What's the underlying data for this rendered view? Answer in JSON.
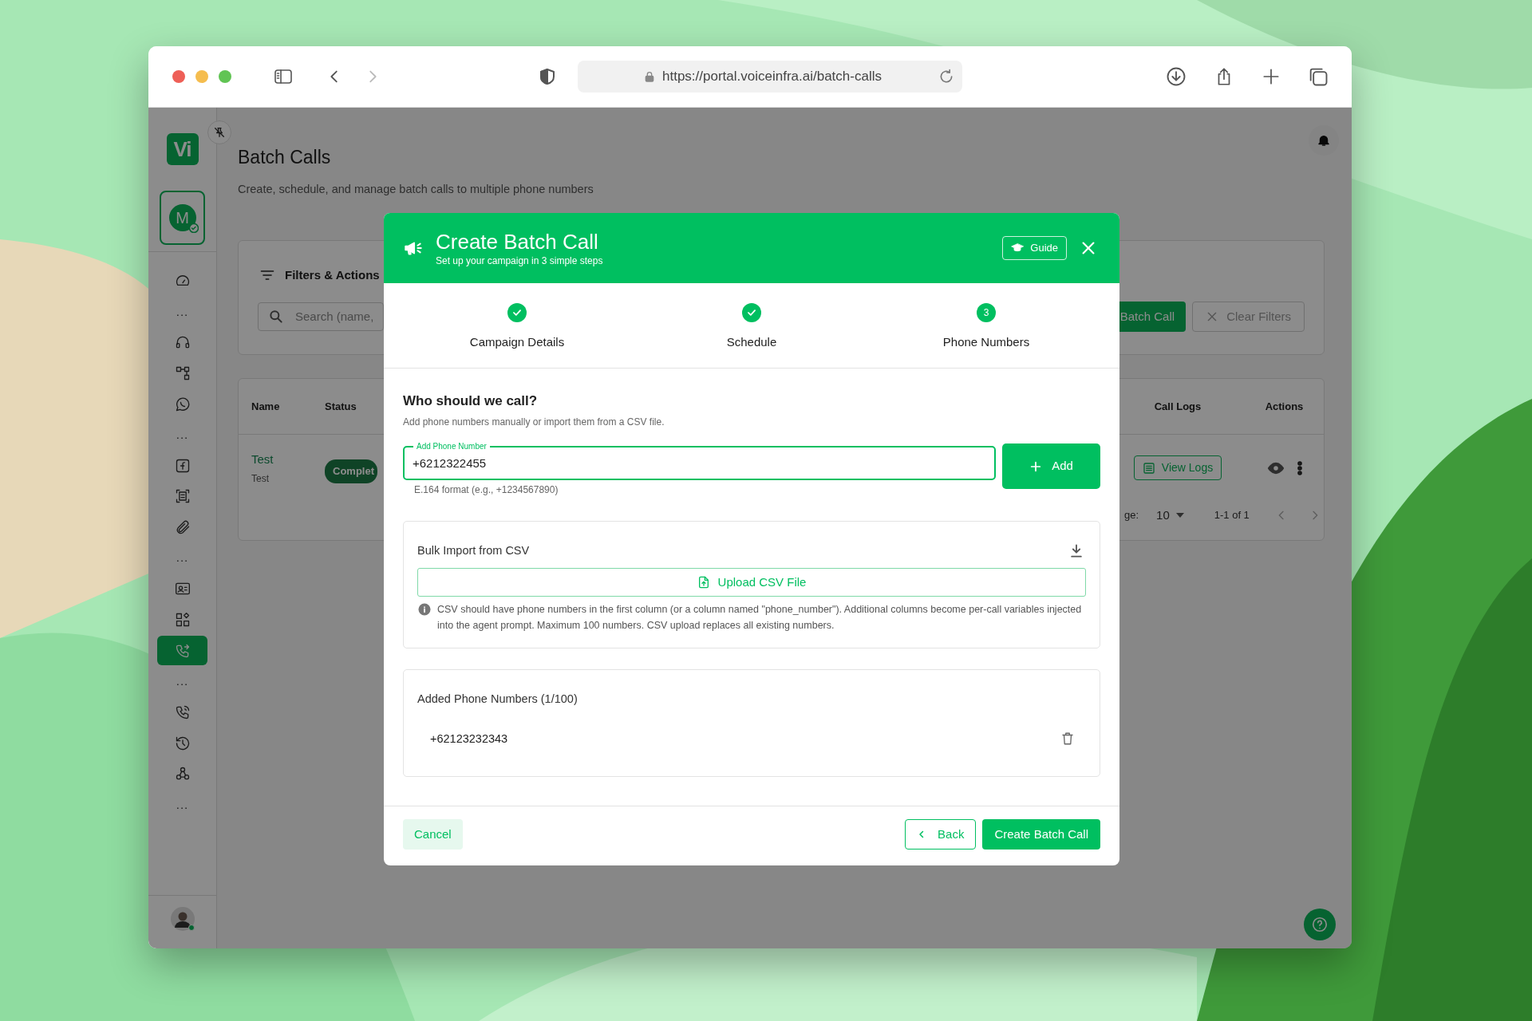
{
  "browser": {
    "url": "https://portal.voiceinfra.ai/batch-calls"
  },
  "sidebar": {
    "logo": "Vi",
    "avatar_initial": "M",
    "items": [
      {
        "kind": "link",
        "selected": false
      },
      {
        "kind": "ellipsis",
        "text": "..."
      },
      {
        "kind": "link",
        "selected": false
      },
      {
        "kind": "link",
        "selected": false
      },
      {
        "kind": "link",
        "selected": false
      },
      {
        "kind": "ellipsis",
        "text": "..."
      },
      {
        "kind": "link",
        "selected": false
      },
      {
        "kind": "link",
        "selected": false
      },
      {
        "kind": "link",
        "selected": false
      },
      {
        "kind": "ellipsis",
        "text": "..."
      },
      {
        "kind": "link",
        "selected": false
      },
      {
        "kind": "link",
        "selected": false
      },
      {
        "kind": "link",
        "selected": true
      },
      {
        "kind": "ellipsis",
        "text": "..."
      },
      {
        "kind": "link",
        "selected": false
      },
      {
        "kind": "link",
        "selected": false
      },
      {
        "kind": "link",
        "selected": false
      },
      {
        "kind": "ellipsis",
        "text": "..."
      }
    ]
  },
  "page": {
    "title": "Batch Calls",
    "subtitle": "Create, schedule, and manage batch calls to multiple phone numbers"
  },
  "filters": {
    "title": "Filters & Actions",
    "search_placeholder": "Search (name,",
    "create_button": "Batch Call",
    "clear_button": "Clear Filters"
  },
  "table": {
    "columns": [
      "Name",
      "Status",
      "Call Logs",
      "Actions"
    ],
    "rows": [
      {
        "name": "Test",
        "description": "Test",
        "status": "Complet",
        "logs_button": "View Logs"
      }
    ],
    "pagination": {
      "rows_label": "ge:",
      "rows_per_page": "10",
      "range": "1-1 of 1"
    }
  },
  "modal": {
    "title": "Create Batch Call",
    "subtitle": "Set up your campaign in 3 simple steps",
    "guide_button": "Guide",
    "steps": [
      {
        "label": "Campaign Details",
        "completed": true
      },
      {
        "label": "Schedule",
        "completed": true
      },
      {
        "label": "Phone Numbers",
        "completed": false,
        "number": "3"
      }
    ],
    "question": "Who should we call?",
    "hint": "Add phone numbers manually or import them from a CSV file.",
    "phone_field": {
      "label": "Add Phone Number",
      "value": "+6212322455",
      "helper": "E.164 format (e.g., +1234567890)"
    },
    "add_button": "Add",
    "bulk": {
      "title": "Bulk Import from CSV",
      "upload_button": "Upload CSV File",
      "note": "CSV should have phone numbers in the first column (or a column named \"phone_number\"). Additional columns become per-call variables injected into the agent prompt. Maximum 100 numbers. CSV upload replaces all existing numbers."
    },
    "added": {
      "title": "Added Phone Numbers (1/100)",
      "numbers": [
        "+62123232343"
      ]
    },
    "footer": {
      "cancel_button": "Cancel",
      "back_button": "Back",
      "submit_button": "Create Batch Call"
    }
  }
}
